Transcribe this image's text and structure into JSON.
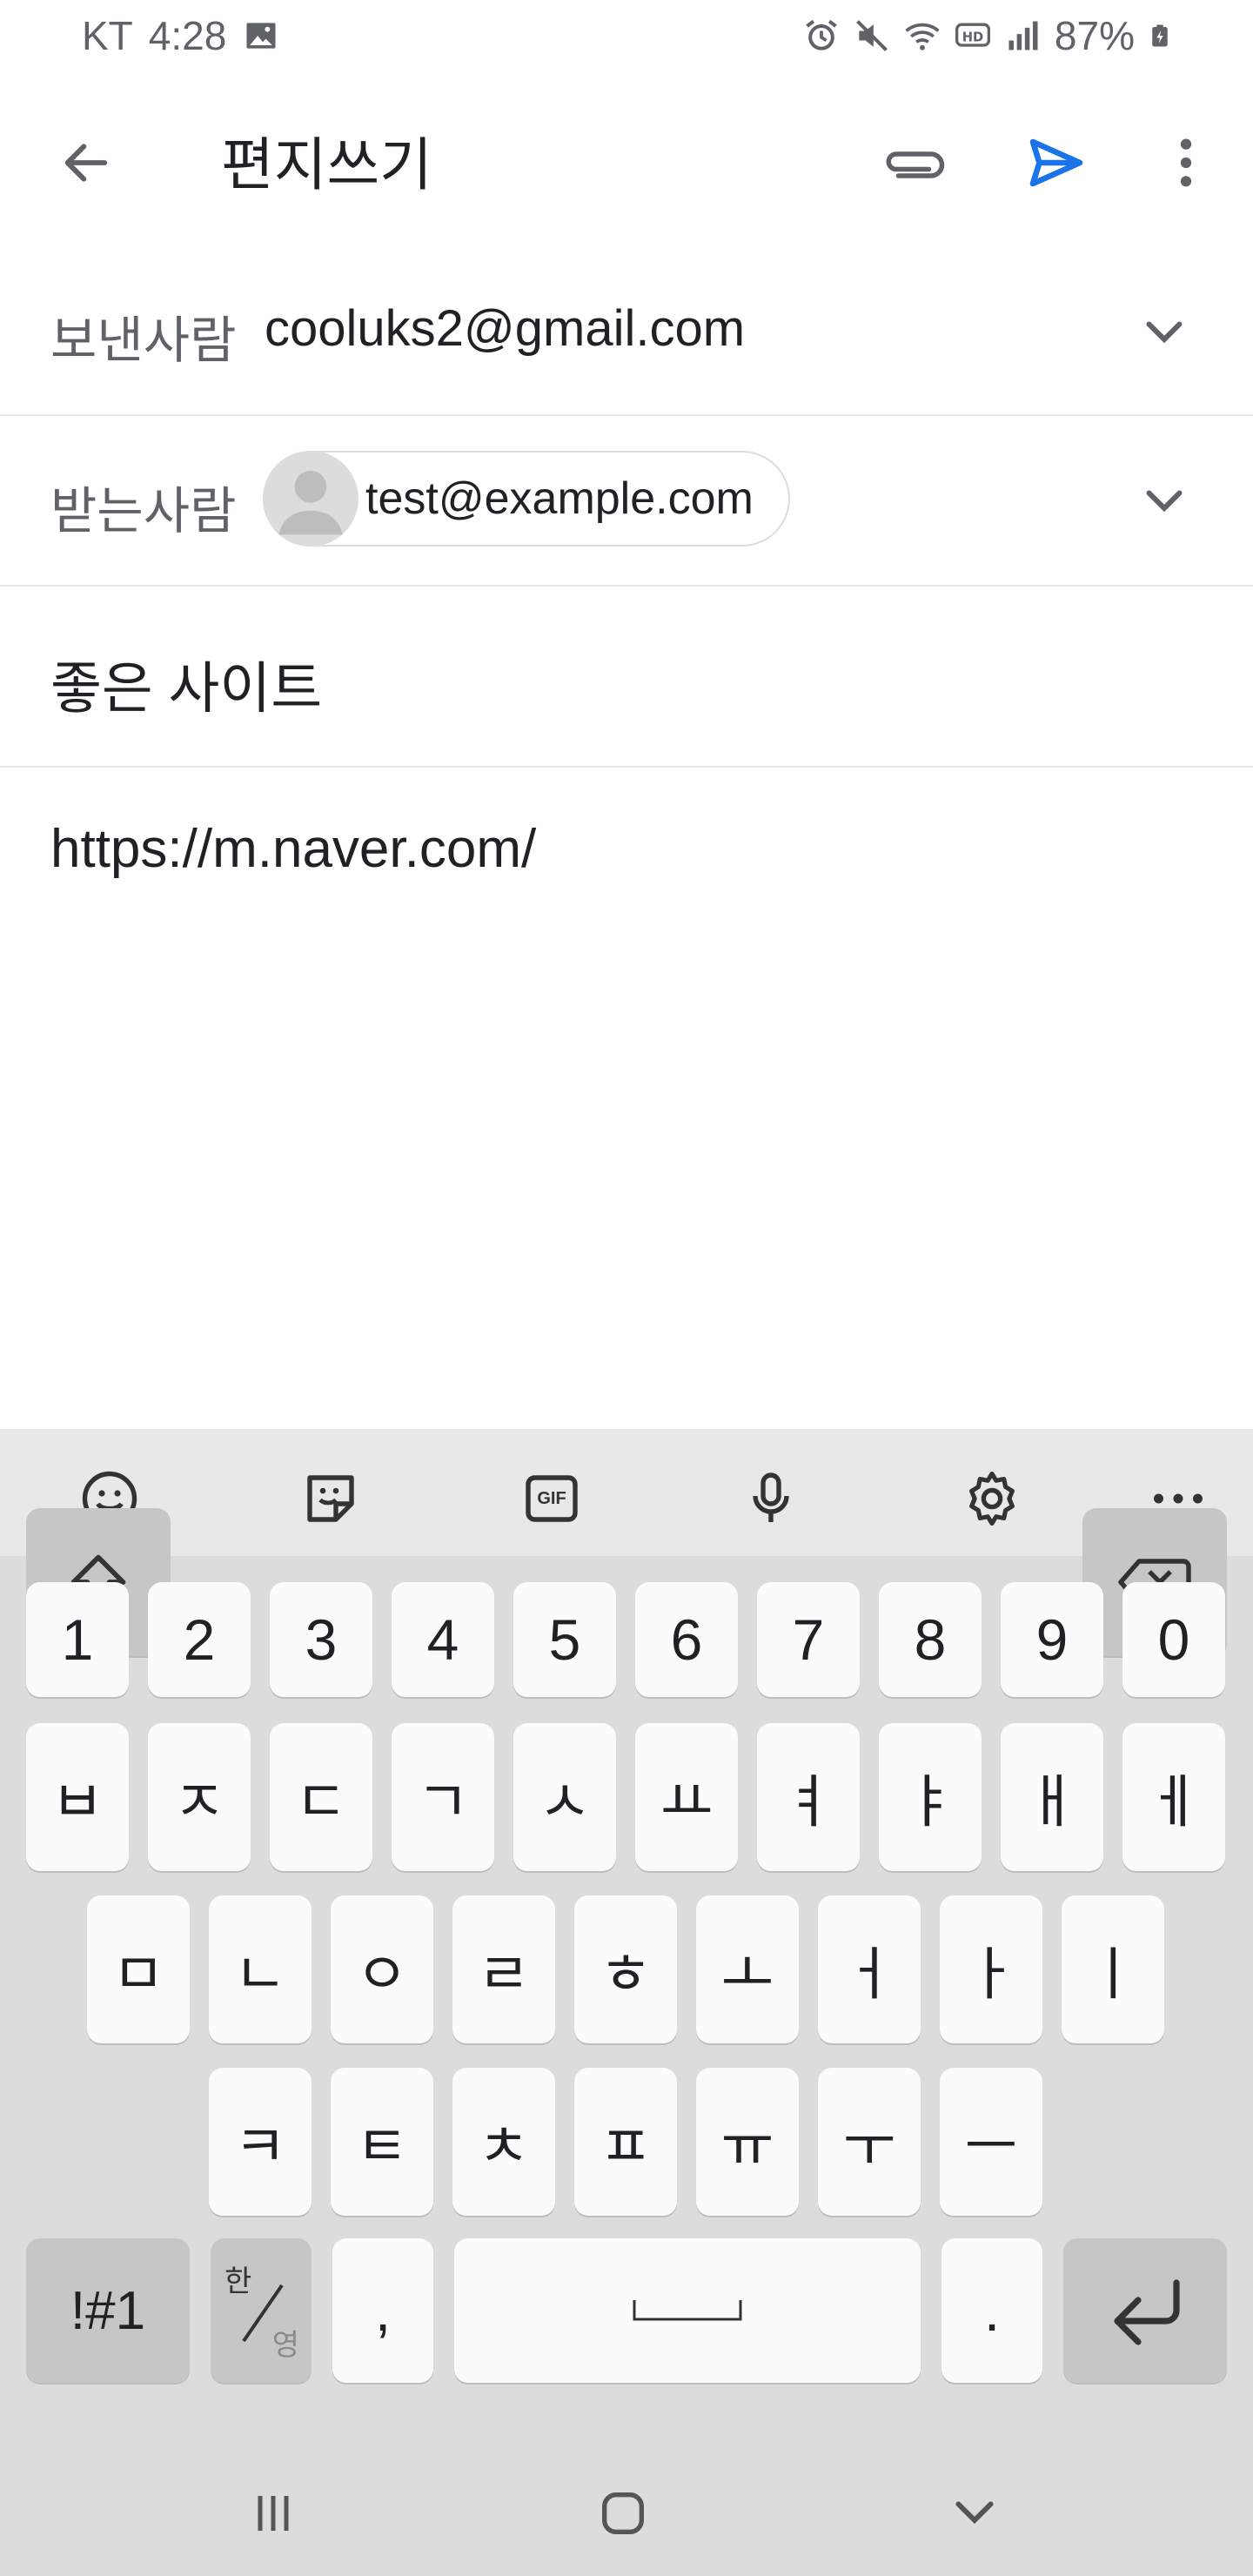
{
  "status_bar": {
    "carrier": "KT",
    "time": "4:28",
    "battery": "87%"
  },
  "toolbar": {
    "title": "편지쓰기",
    "icons": [
      "back-arrow-icon",
      "paperclip-icon",
      "send-icon",
      "more-vert-icon"
    ],
    "accent": "#1a73e8"
  },
  "from_row": {
    "label": "보낸사람",
    "value": "cooluks2@gmail.com"
  },
  "to_row": {
    "label": "받는사람",
    "chip": "test@example.com"
  },
  "subject": "좋은 사이트",
  "body": "https://m.naver.com/",
  "keyboard": {
    "toolbar_icons": [
      "emoji-icon",
      "sticker-icon",
      "gif-icon",
      "mic-icon",
      "settings-icon",
      "more-horiz-icon"
    ],
    "gif_label": "GIF",
    "row_numbers": [
      "1",
      "2",
      "3",
      "4",
      "5",
      "6",
      "7",
      "8",
      "9",
      "0"
    ],
    "row1": [
      "ㅂ",
      "ㅈ",
      "ㄷ",
      "ㄱ",
      "ㅅ",
      "ㅛ",
      "ㅕ",
      "ㅑ",
      "ㅐ",
      "ㅔ"
    ],
    "row2": [
      "ㅁ",
      "ㄴ",
      "ㅇ",
      "ㄹ",
      "ㅎ",
      "ㅗ",
      "ㅓ",
      "ㅏ",
      "ㅣ"
    ],
    "row3": [
      "ㅋ",
      "ㅌ",
      "ㅊ",
      "ㅍ",
      "ㅠ",
      "ㅜ",
      "ㅡ"
    ],
    "symbols_key": "!#1",
    "lang_key_top": "한",
    "lang_key_bottom": "영",
    "comma_key": ",",
    "period_key": "."
  }
}
